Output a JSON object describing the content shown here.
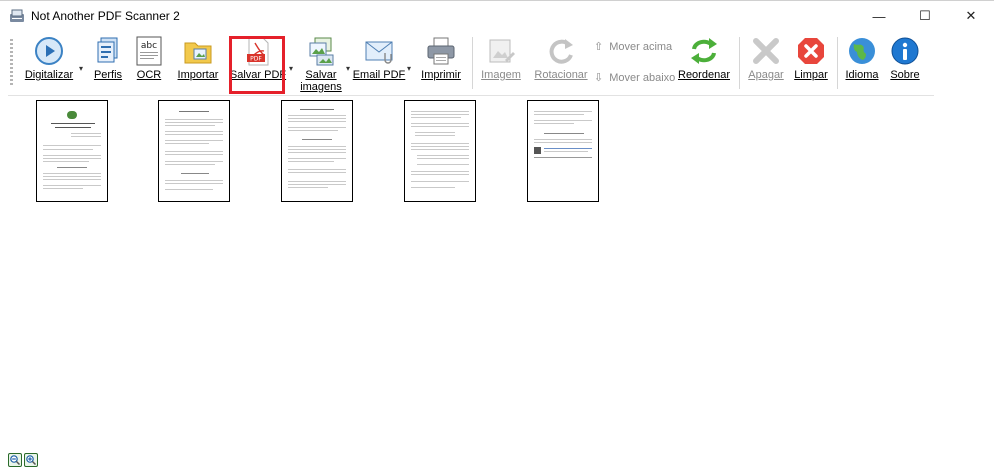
{
  "window": {
    "title": "Not Another PDF Scanner 2",
    "controls": {
      "minimize": "—",
      "maximize": "☐",
      "close": "✕"
    }
  },
  "toolbar": {
    "digitalizar": "Digitalizar",
    "perfis": "Perfis",
    "ocr": "OCR",
    "importar": "Importar",
    "salvar_pdf": "Salvar PDF",
    "salvar_imagens_1": "Salvar",
    "salvar_imagens_2": "imagens",
    "email_pdf": "Email PDF",
    "imprimir": "Imprimir",
    "imagem": "Imagem",
    "rotacionar": "Rotacionar",
    "mover_acima": "Mover acima",
    "mover_abaixo": "Mover abaixo",
    "reordenar": "Reordenar",
    "apagar": "Apagar",
    "limpar": "Limpar",
    "idioma": "Idioma",
    "sobre": "Sobre",
    "ocr_icon_text": "abc",
    "pdf_icon_text": "PDF"
  },
  "highlighted_button": "salvar_pdf",
  "colors": {
    "highlight": "#e5202a",
    "accent_blue": "#1a73c8"
  },
  "pages": [
    "page-1",
    "page-2",
    "page-3",
    "page-4",
    "page-5"
  ],
  "zoom": {
    "out": "zoom-out",
    "in": "zoom-in"
  }
}
